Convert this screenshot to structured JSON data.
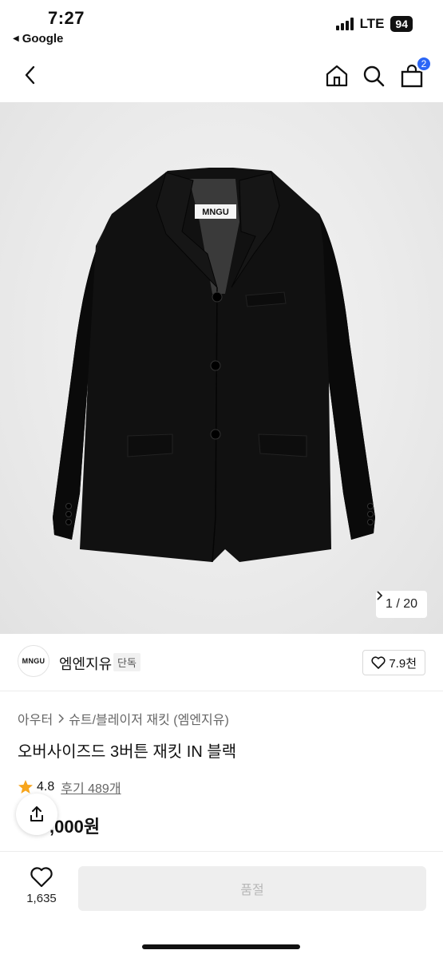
{
  "status_bar": {
    "time": "7:27",
    "back_app": "Google",
    "network": "LTE",
    "battery": "94"
  },
  "nav": {
    "cart_count": "2",
    "icons": [
      "chevron-left-icon",
      "home-icon",
      "search-icon",
      "shopping-bag-icon"
    ],
    "badge_color": "#2b66f6"
  },
  "hero": {
    "label_text": "MNGU",
    "counter": "1 / 20"
  },
  "brand": {
    "logo_text": "MNGU",
    "name": "엠엔지유",
    "badge": "단독",
    "likes": "7.9천"
  },
  "product": {
    "breadcrumb": [
      "아우터",
      "슈트/블레이저 재킷 (엠엔지유)"
    ],
    "title": "오버사이즈드 3버튼 재킷 IN 블랙",
    "rating": "4.8",
    "reviews": "후기 489개",
    "price": ",000원"
  },
  "bottom": {
    "wish_count": "1,635",
    "buy_label": "품절"
  }
}
